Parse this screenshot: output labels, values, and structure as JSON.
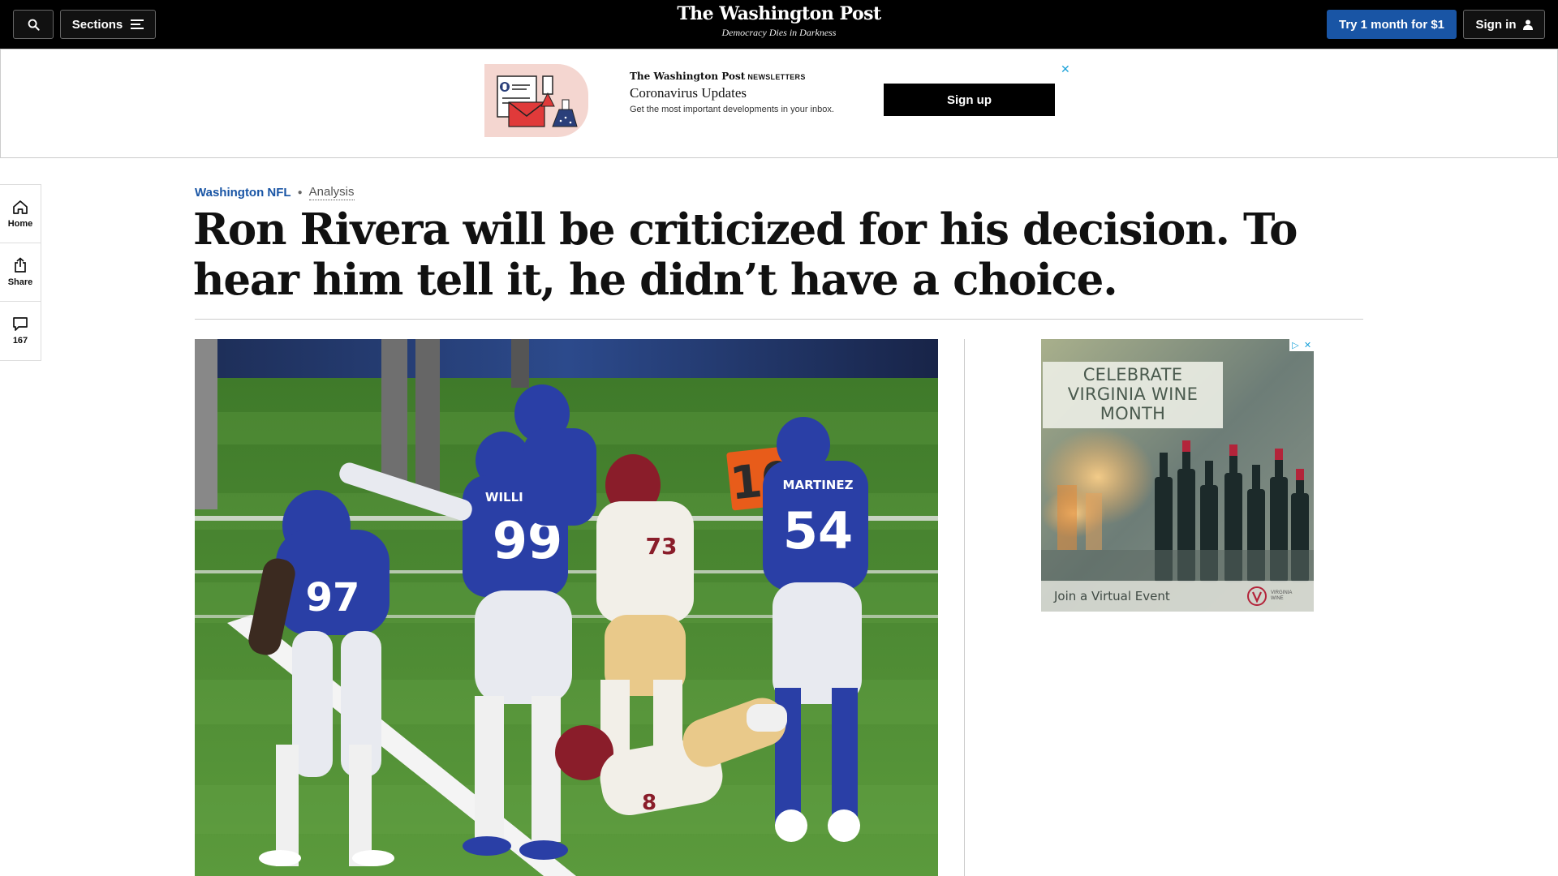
{
  "topnav": {
    "sections_label": "Sections",
    "logo": "The Washington Post",
    "tagline": "Democracy Dies in Darkness",
    "subscribe_label": "Try 1 month for $1",
    "signin_label": "Sign in"
  },
  "newsletter_ad": {
    "brand": "The Washington Post",
    "brand_suffix": "NEWSLETTERS",
    "title": "Coronavirus Updates",
    "description": "Get the most important developments in your inbox.",
    "signup_label": "Sign up",
    "close_glyph": "✕"
  },
  "rail": {
    "home_label": "Home",
    "share_label": "Share",
    "comments_count": "167"
  },
  "article": {
    "section": "Washington NFL",
    "label": "Analysis",
    "headline": "Ron Rivera will be criticized for his decision. To hear him tell it, he didn’t have a choice."
  },
  "photo": {
    "marker": "10",
    "jersey_numbers": [
      "97",
      "99",
      "73",
      "54",
      "8"
    ],
    "jersey_names": [
      "WILLIAMS",
      "MARTINEZ"
    ]
  },
  "side_ad": {
    "headline": "CELEBRATE VIRGINIA WINE MONTH",
    "cta": "Join a Virtual Event",
    "brand": "VIRGINIA WINE",
    "choices": [
      "▷",
      "✕"
    ]
  },
  "colors": {
    "nav_bg": "#000000",
    "accent_blue": "#1955a5",
    "giants_blue": "#2a3fa6",
    "burgundy": "#8a1d2a",
    "field_green": "#4f8a33"
  }
}
